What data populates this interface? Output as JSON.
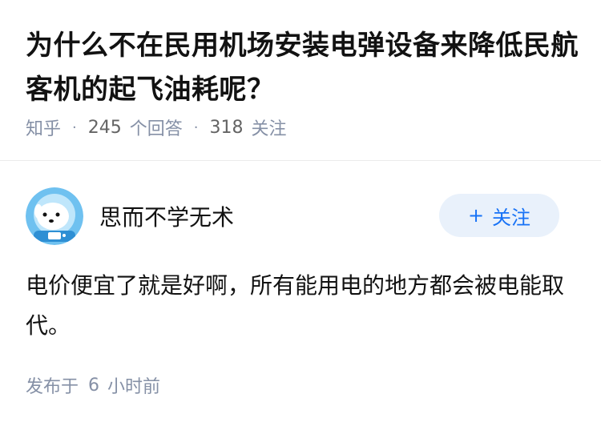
{
  "question": {
    "title": "为什么不在民用机场安装电弹设备来降低民航客机的起飞油耗呢？",
    "meta": {
      "site": "知乎",
      "answers_count": "245",
      "answers_unit": "个回答",
      "follows_count": "318",
      "follows_unit": "关注"
    }
  },
  "answer": {
    "author_name": "思而不学无术",
    "follow_button": {
      "plus": "+",
      "label": "关注"
    },
    "text": "电价便宜了就是好啊，所有能用电的地方都会被电能取代。",
    "published_prefix": "发布于",
    "published_num": "6",
    "published_suffix": "小时前"
  },
  "colors": {
    "accent": "#1772f6",
    "meta": "#8590a6",
    "avatar_bg": "#6fc1f0"
  }
}
